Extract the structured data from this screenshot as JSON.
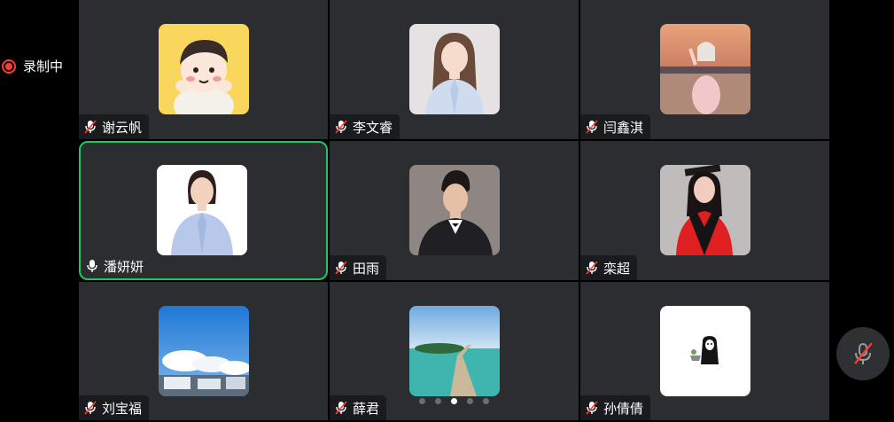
{
  "recording": {
    "label": "录制中",
    "color": "#ff3b30"
  },
  "accent_active": "#22c55e",
  "participants": [
    {
      "name": "谢云帆",
      "mic": "muted",
      "avatar": "cartoon-boy"
    },
    {
      "name": "李文睿",
      "mic": "muted",
      "avatar": "portrait-woman-blue-shirt"
    },
    {
      "name": "闫鑫淇",
      "mic": "muted",
      "avatar": "sunset-girl-illustration"
    },
    {
      "name": "潘妍妍",
      "mic": "on",
      "active": true,
      "avatar": "portrait-woman-light-blue-shirt"
    },
    {
      "name": "田雨",
      "mic": "muted",
      "avatar": "portrait-man-suit"
    },
    {
      "name": "栾超",
      "mic": "muted",
      "avatar": "graduation-portrait"
    },
    {
      "name": "刘宝福",
      "mic": "muted",
      "avatar": "sky-buildings-photo"
    },
    {
      "name": "薛君",
      "mic": "muted",
      "avatar": "island-boardwalk-photo"
    },
    {
      "name": "孙倩倩",
      "mic": "muted",
      "avatar": "ghost-figure-sketch"
    }
  ],
  "pagination": {
    "total": 5,
    "current": 3
  },
  "controls": {
    "mute_button_icon": "mic-off-icon"
  }
}
